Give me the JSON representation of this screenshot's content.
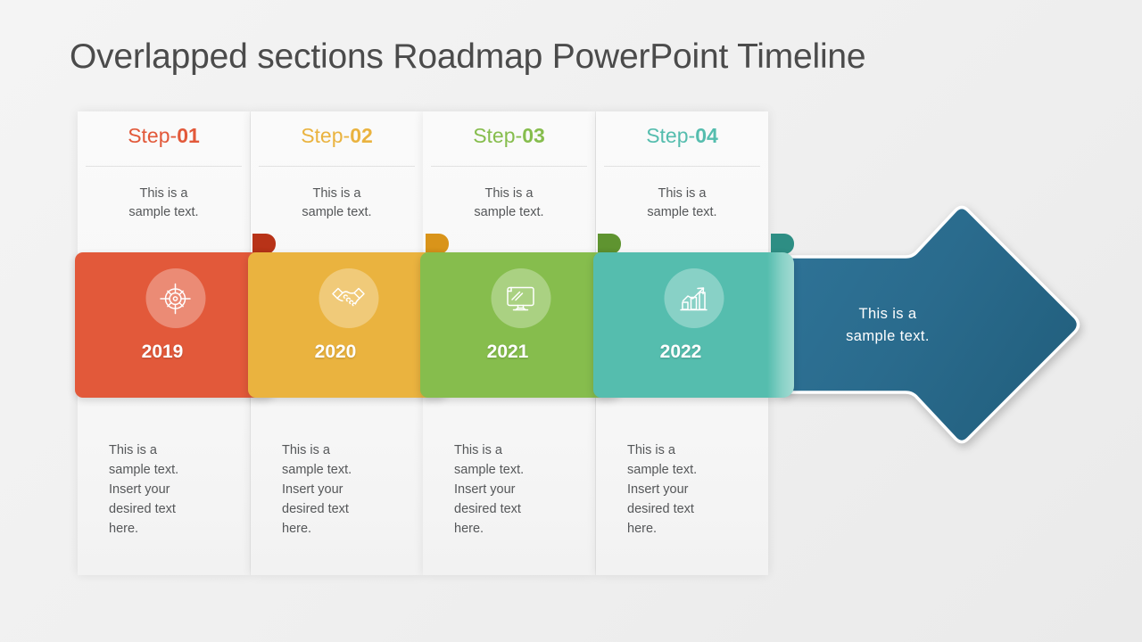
{
  "slide": {
    "title": "Overlapped sections Roadmap PowerPoint Timeline",
    "background_color": "#f2f2f2",
    "title_color": "#4b4b4b"
  },
  "steps": [
    {
      "step_label": "Step-",
      "step_number": "01",
      "color": "#e2593a",
      "fold_color": "#b83318",
      "top_text": "This is a\nsample text.",
      "year": "2019",
      "icon": "target-icon",
      "bottom_text": "This is a\nsample text.\nInsert your\ndesired text\nhere."
    },
    {
      "step_label": "Step-",
      "step_number": "02",
      "color": "#eab33f",
      "fold_color": "#d9941a",
      "top_text": "This is a\nsample text.",
      "year": "2020",
      "icon": "handshake-icon",
      "bottom_text": "This is a\nsample text.\nInsert your\ndesired text\nhere."
    },
    {
      "step_label": "Step-",
      "step_number": "03",
      "color": "#86bd4d",
      "fold_color": "#5f9430",
      "top_text": "This is a\nsample text.",
      "year": "2021",
      "icon": "monitor-icon",
      "bottom_text": "This is a\nsample text.\nInsert your\ndesired text\nhere."
    },
    {
      "step_label": "Step-",
      "step_number": "04",
      "color": "#55bdae",
      "fold_color": "#2e8e84",
      "top_text": "This is a\nsample text.",
      "year": "2022",
      "icon": "growth-chart-icon",
      "bottom_text": "This is a\nsample text.\nInsert your\ndesired text\nhere."
    }
  ],
  "arrow": {
    "text": "This  is a\nsample  text.",
    "color": "#2b6e92",
    "color_dark": "#2a6385",
    "outline_color": "#ffffff"
  }
}
